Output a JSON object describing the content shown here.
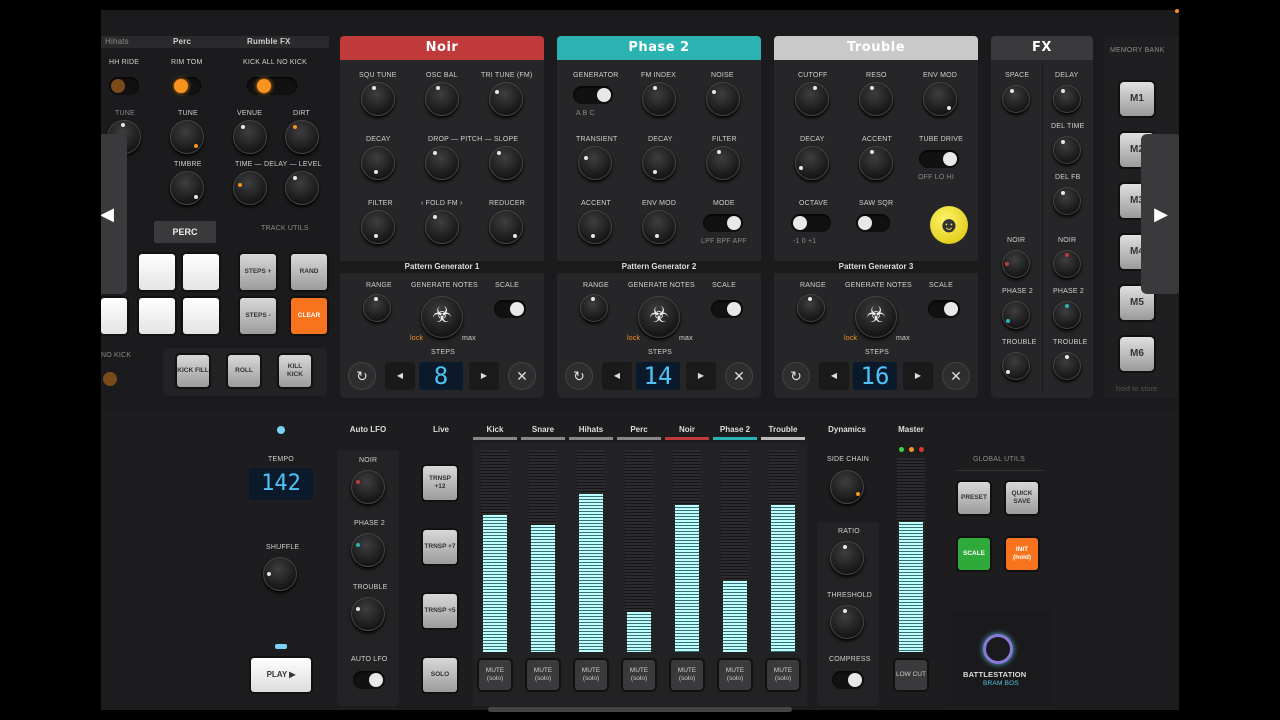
{
  "perc": {
    "tabs": [
      "Hihats",
      "Perc",
      "Rumble FX"
    ],
    "hh_toggle_labels": "HH  RIDE",
    "rim_toggle_labels": "RIM  TOM",
    "kick_toggle_labels": "KICK  ALL  NO KICK",
    "tune": "TUNE",
    "tune2": "TUNE",
    "timbre": "TIMBRE",
    "venue": "VENUE",
    "dirt": "DIRT",
    "time_delay_level": "TIME — DELAY — LEVEL",
    "perc_button": "PERC",
    "track_utils": "TRACK UTILS",
    "steps_plus": "STEPS +",
    "rand": "RAND",
    "steps_minus": "STEPS -",
    "clear": "CLEAR",
    "no_kick": "NO KICK",
    "kick_fill": "KICK FILL",
    "roll": "ROLL",
    "kill_kick": "KILL KICK"
  },
  "noir": {
    "title": "Noir",
    "color": "#c0393b",
    "k": [
      "SQU TUNE",
      "OSC BAL",
      "TRI TUNE (FM)",
      "DECAY",
      "DROP — PITCH — SLOPE",
      "FILTER",
      "‹ FOLD  FM ›",
      "REDUCER"
    ],
    "pg": "Pattern Generator 1",
    "range": "RANGE",
    "gen": "GENERATE NOTES",
    "scale": "SCALE",
    "lock": "lock",
    "max": "max",
    "steps_label": "STEPS",
    "steps": "8"
  },
  "phase2": {
    "title": "Phase 2",
    "color": "#2ab3b1",
    "k": [
      "GENERATOR",
      "FM INDEX",
      "NOISE",
      "TRANSIENT",
      "DECAY",
      "FILTER",
      "ACCENT",
      "ENV MOD",
      "MODE"
    ],
    "gen_abc": "A   B   C",
    "mode_opts": "LPF  BPF  APF",
    "pg": "Pattern Generator 2",
    "range": "RANGE",
    "gen": "GENERATE NOTES",
    "scale": "SCALE",
    "lock": "lock",
    "max": "max",
    "steps_label": "STEPS",
    "steps": "14"
  },
  "trouble": {
    "title": "Trouble",
    "color": "#bdbdbd",
    "k": [
      "CUTOFF",
      "RESO",
      "ENV MOD",
      "DECAY",
      "ACCENT",
      "TUBE DRIVE",
      "OCTAVE",
      "SAW  SQR"
    ],
    "tube_opts": "OFF   LO   HI",
    "oct_opts": "-1   0  +1",
    "pg": "Pattern Generator 3",
    "range": "RANGE",
    "gen": "GENERATE NOTES",
    "scale": "SCALE",
    "lock": "lock",
    "max": "max",
    "steps_label": "STEPS",
    "steps": "16"
  },
  "fx": {
    "title": "FX",
    "l": [
      "SPACE",
      "DELAY",
      "DEL TIME",
      "DEL FB",
      "NOIR",
      "NOIR",
      "PHASE 2",
      "PHASE 2",
      "TROUBLE",
      "TROUBLE"
    ]
  },
  "memory": {
    "title": "MEMORY BANK",
    "slots": [
      "M1",
      "M2",
      "M3",
      "M4",
      "M5",
      "M6"
    ],
    "hint": "hold to store"
  },
  "transport": {
    "tempo_label": "TEMPO",
    "tempo": "142",
    "shuffle": "SHUFFLE",
    "play": "PLAY ▶"
  },
  "autolfo": {
    "title": "Auto LFO",
    "l": [
      "NOIR",
      "PHASE 2",
      "TROUBLE",
      "AUTO LFO"
    ]
  },
  "live": {
    "title": "Live",
    "b": [
      "TRNSP +12",
      "TRNSP +7",
      "TRNSP +5",
      "SOLO"
    ]
  },
  "mixer": {
    "channels": [
      {
        "name": "Kick",
        "level": 0.68,
        "color": "#888888"
      },
      {
        "name": "Snare",
        "level": 0.63,
        "color": "#888888"
      },
      {
        "name": "Hihats",
        "level": 0.78,
        "color": "#888888"
      },
      {
        "name": "Perc",
        "level": 0.2,
        "color": "#888888"
      },
      {
        "name": "Noir",
        "level": 0.73,
        "color": "#c0393b"
      },
      {
        "name": "Phase 2",
        "level": 0.35,
        "color": "#2ab3b1"
      },
      {
        "name": "Trouble",
        "level": 0.73,
        "color": "#bdbdbd"
      }
    ],
    "mute": "MUTE (solo)"
  },
  "dynamics": {
    "title": "Dynamics",
    "l": [
      "SIDE CHAIN",
      "RATIO",
      "THRESHOLD",
      "COMPRESS"
    ]
  },
  "master": {
    "title": "Master",
    "level": 0.67,
    "low_cut": "LOW CUT"
  },
  "global": {
    "title": "GLOBAL UTILS",
    "preset": "PRESET",
    "quick_save": "QUICK SAVE",
    "scale": "SCALE",
    "init": "INIT (hold)"
  },
  "brand": {
    "name": "BATTLESTATION",
    "by": "BRAM BOS"
  }
}
